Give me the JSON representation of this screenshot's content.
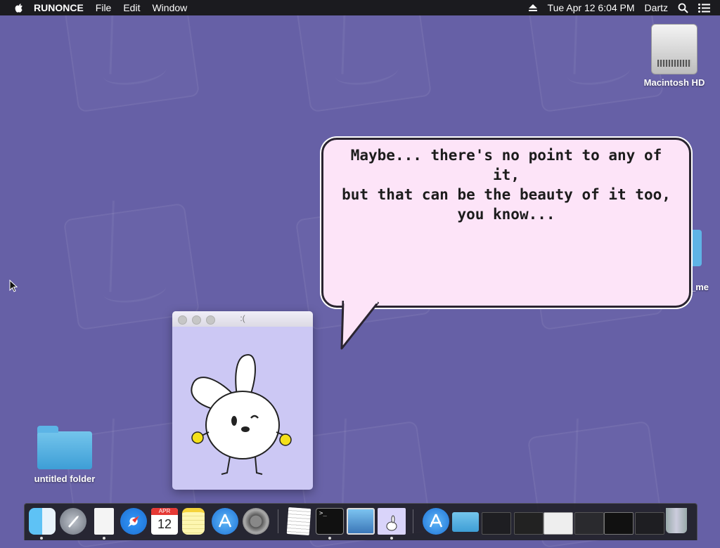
{
  "menubar": {
    "app_name": "RUNONCE",
    "menus": [
      "File",
      "Edit",
      "Window"
    ],
    "datetime": "Tue Apr 12  6:04 PM",
    "user": "Dartz"
  },
  "desktop": {
    "hd_label": "Macintosh HD",
    "folder_label": "untitled folder",
    "partial_label": "_me"
  },
  "bubble": {
    "text": "Maybe... there's no point to any of it,\nbut that can be the beauty of it too,\nyou know..."
  },
  "window": {
    "title": ":("
  },
  "dock": {
    "calendar_month": "APR",
    "calendar_day": "12"
  },
  "colors": {
    "desktop": "#6660a6",
    "bubble_fill": "#fde4f8",
    "window_bg": "#ccc8f4"
  }
}
